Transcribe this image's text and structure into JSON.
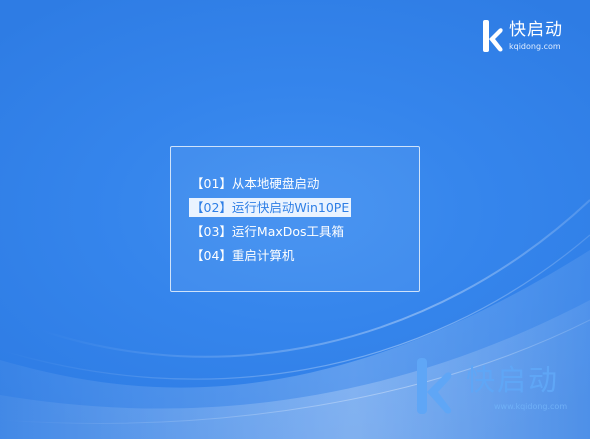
{
  "screen": {
    "background_color": "#2f7fe6"
  },
  "logo_top": {
    "brand": "快启动",
    "domain": "kqidong.com",
    "icon": "k-logo-icon"
  },
  "logo_bottom": {
    "brand": "快启动",
    "domain": "www.kqidong.com",
    "icon": "k-logo-icon"
  },
  "boot_menu": {
    "selected_index": 1,
    "selected_bg_color": "#eaf3ff",
    "items": [
      {
        "label": "【01】从本地硬盘启动"
      },
      {
        "label": "【02】运行快启动Win10PE"
      },
      {
        "label": "【03】运行MaxDos工具箱"
      },
      {
        "label": "【04】重启计算机"
      }
    ]
  }
}
